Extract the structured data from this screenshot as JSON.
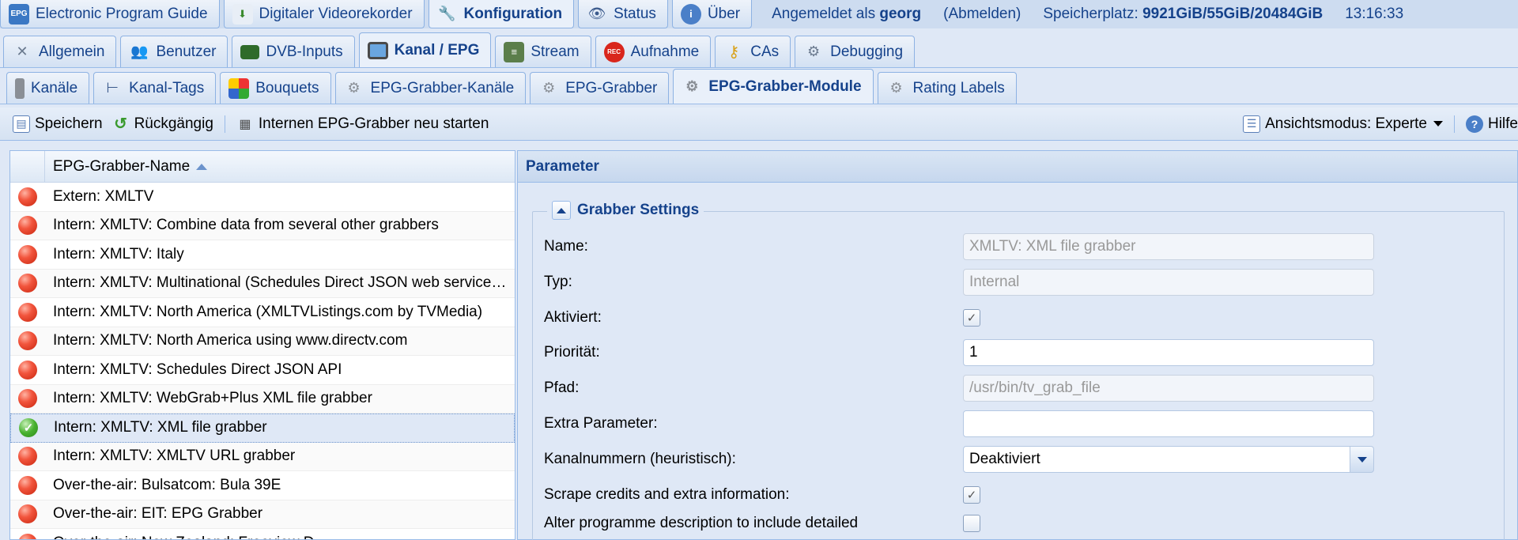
{
  "top_tabs": [
    {
      "label": "Electronic Program Guide",
      "icon": "epg-icon",
      "active": false
    },
    {
      "label": "Digitaler Videorekorder",
      "icon": "download-icon",
      "active": false
    },
    {
      "label": "Konfiguration",
      "icon": "wrench-icon",
      "active": true
    },
    {
      "label": "Status",
      "icon": "eye-icon",
      "active": false
    },
    {
      "label": "Über",
      "icon": "info-icon",
      "active": false
    }
  ],
  "status": {
    "logged_in_prefix": "Angemeldet als",
    "username": "georg",
    "logout": "(Abmelden)",
    "storage_label": "Speicherplatz:",
    "storage_value": "9921GiB/55GiB/20484GiB",
    "time": "13:16:33"
  },
  "config_tabs": [
    {
      "label": "Allgemein",
      "icon": "tools-icon",
      "active": false
    },
    {
      "label": "Benutzer",
      "icon": "users-icon",
      "active": false
    },
    {
      "label": "DVB-Inputs",
      "icon": "card-icon",
      "active": false
    },
    {
      "label": "Kanal / EPG",
      "icon": "tv-icon",
      "active": true
    },
    {
      "label": "Stream",
      "icon": "stream-icon",
      "active": false
    },
    {
      "label": "Aufnahme",
      "icon": "rec-icon",
      "active": false
    },
    {
      "label": "CAs",
      "icon": "key-icon",
      "active": false
    },
    {
      "label": "Debugging",
      "icon": "bug-icon",
      "active": false
    }
  ],
  "sub_tabs": [
    {
      "label": "Kanäle",
      "icon": "remote-icon",
      "active": false
    },
    {
      "label": "Kanal-Tags",
      "icon": "tree-icon",
      "active": false
    },
    {
      "label": "Bouquets",
      "icon": "grid-icon",
      "active": false
    },
    {
      "label": "EPG-Grabber-Kanäle",
      "icon": "gear-icon",
      "active": false
    },
    {
      "label": "EPG-Grabber",
      "icon": "gear-icon",
      "active": false
    },
    {
      "label": "EPG-Grabber-Module",
      "icon": "gear-icon",
      "active": true
    },
    {
      "label": "Rating Labels",
      "icon": "gear-icon",
      "active": false
    }
  ],
  "toolbar": {
    "save": "Speichern",
    "undo": "Rückgängig",
    "restart": "Internen EPG-Grabber neu starten",
    "view_mode": "Ansichtsmodus: Experte",
    "help": "Hilfe"
  },
  "grid": {
    "column_name": "EPG-Grabber-Name",
    "rows": [
      {
        "name": "Extern: XMLTV",
        "enabled": false
      },
      {
        "name": "Intern: XMLTV: Combine data from several other grabbers",
        "enabled": false
      },
      {
        "name": "Intern: XMLTV: Italy",
        "enabled": false
      },
      {
        "name": "Intern: XMLTV: Multinational (Schedules Direct JSON web service…",
        "enabled": false
      },
      {
        "name": "Intern: XMLTV: North America (XMLTVListings.com by TVMedia)",
        "enabled": false
      },
      {
        "name": "Intern: XMLTV: North America using www.directv.com",
        "enabled": false
      },
      {
        "name": "Intern: XMLTV: Schedules Direct JSON API",
        "enabled": false
      },
      {
        "name": "Intern: XMLTV: WebGrab+Plus XML file grabber",
        "enabled": false
      },
      {
        "name": "Intern: XMLTV: XML file grabber",
        "enabled": true,
        "selected": true
      },
      {
        "name": "Intern: XMLTV: XMLTV URL grabber",
        "enabled": false
      },
      {
        "name": "Over-the-air: Bulsatcom: Bula 39E",
        "enabled": false
      },
      {
        "name": "Over-the-air: EIT: EPG Grabber",
        "enabled": false
      },
      {
        "name": "Over-the-air: New Zealand: Freeview D…",
        "enabled": false
      }
    ]
  },
  "params": {
    "title": "Parameter",
    "section": "Grabber Settings",
    "fields": {
      "name_label": "Name:",
      "name_value": "XMLTV: XML file grabber",
      "type_label": "Typ:",
      "type_value": "Internal",
      "enabled_label": "Aktiviert:",
      "enabled_checked": true,
      "priority_label": "Priorität:",
      "priority_value": "1",
      "path_label": "Pfad:",
      "path_value": "/usr/bin/tv_grab_file",
      "extra_label": "Extra Parameter:",
      "extra_value": "",
      "channelnum_label": "Kanalnummern (heuristisch):",
      "channelnum_value": "Deaktiviert",
      "scrape_label": "Scrape credits and extra information:",
      "scrape_checked": true,
      "alter_label": "Alter programme description to include detailed",
      "alter_checked": false
    }
  },
  "colors": {
    "accent": "#15428b",
    "panel": "#dfe8f6",
    "border": "#99bbe8"
  }
}
